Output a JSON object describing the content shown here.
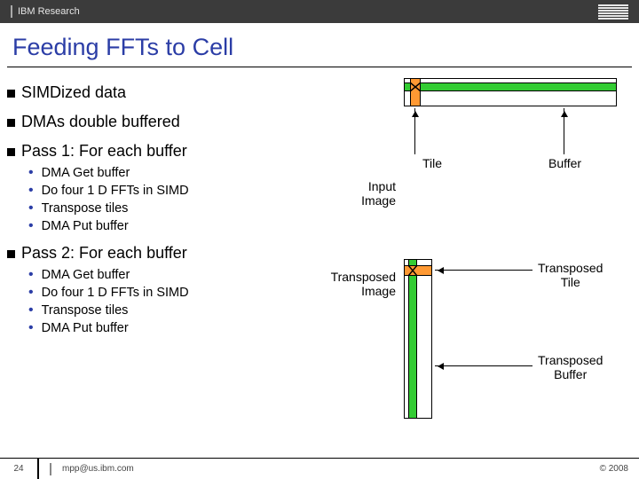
{
  "header": {
    "brand": "IBM Research"
  },
  "title": "Feeding FFTs to Cell",
  "bullets": {
    "b1": "SIMDized data",
    "b2": "DMAs double buffered",
    "b3": "Pass 1: For each buffer",
    "b4": "Pass 2: For each buffer"
  },
  "sub1": {
    "s1": "DMA Get buffer",
    "s2": "Do  four 1 D FFTs in SIMD",
    "s3": "Transpose tiles",
    "s4": "DMA Put buffer"
  },
  "sub2": {
    "s1": "DMA Get buffer",
    "s2": "Do  four 1 D FFTs in SIMD",
    "s3": "Transpose tiles",
    "s4": "DMA Put buffer"
  },
  "labels": {
    "tile": "Tile",
    "buffer": "Buffer",
    "input": "Input\nImage",
    "transposed_image": "Transposed\nImage",
    "transposed_tile": "Transposed\nTile",
    "transposed_buffer": "Transposed\nBuffer"
  },
  "footer": {
    "page": "24",
    "mail": "mpp@us.ibm.com",
    "copyright": "© 2008"
  }
}
